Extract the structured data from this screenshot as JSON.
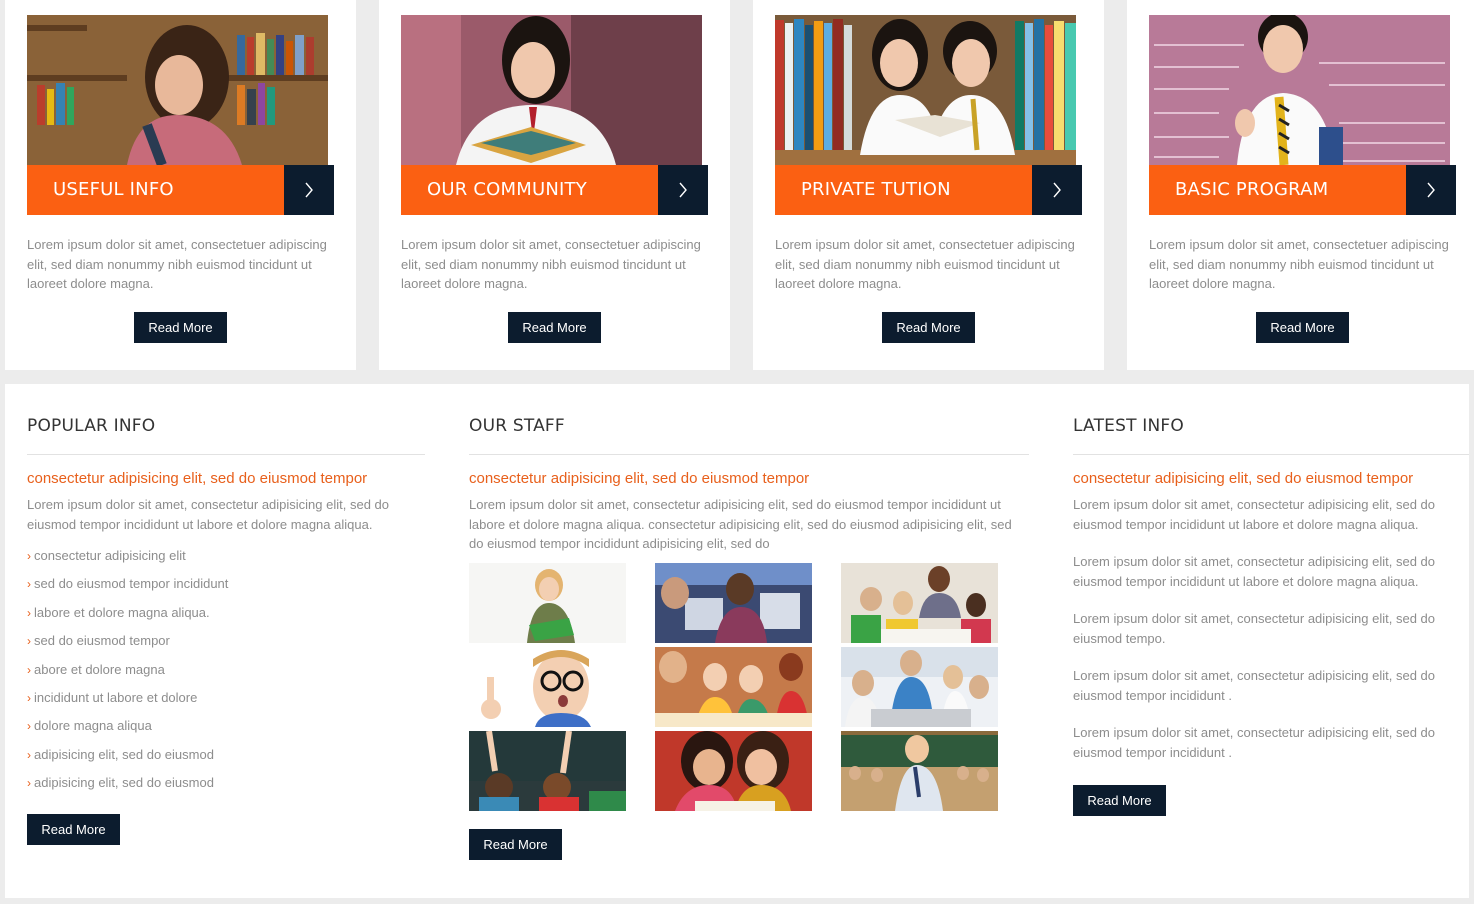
{
  "cards": [
    {
      "title": "USEFUL INFO",
      "desc": "Lorem ipsum dolor sit amet, consectetuer adipiscing elit, sed diam nonummy nibh euismod tincidunt ut laoreet dolore magna.",
      "button": "Read More"
    },
    {
      "title": "OUR COMMUNITY",
      "desc": "Lorem ipsum dolor sit amet, consectetuer adipiscing elit, sed diam nonummy nibh euismod tincidunt ut laoreet dolore magna.",
      "button": "Read More"
    },
    {
      "title": "PRIVATE TUTION",
      "desc": "Lorem ipsum dolor sit amet, consectetuer adipiscing elit, sed diam nonummy nibh euismod tincidunt ut laoreet dolore magna.",
      "button": "Read More"
    },
    {
      "title": "BASIC PROGRAM",
      "desc": "Lorem ipsum dolor sit amet, consectetuer adipiscing elit, sed diam nonummy nibh euismod tincidunt ut laoreet dolore magna.",
      "button": "Read More"
    }
  ],
  "popular": {
    "heading": "POPULAR INFO",
    "subheading": "consectetur adipisicing elit, sed do eiusmod tempor",
    "text": "Lorem ipsum dolor sit amet, consectetur adipisicing elit, sed do eiusmod tempor incididunt ut labore et dolore magna aliqua.",
    "items": [
      "consectetur adipisicing elit",
      "sed do eiusmod tempor incididunt",
      "labore et dolore magna aliqua.",
      "sed do eiusmod tempor",
      "abore et dolore magna",
      "incididunt ut labore et dolore",
      "dolore magna aliqua",
      "adipisicing elit, sed do eiusmod",
      "adipisicing elit, sed do eiusmod"
    ],
    "button": "Read More"
  },
  "staff": {
    "heading": "OUR STAFF",
    "subheading": "consectetur adipisicing elit, sed do eiusmod tempor",
    "text": "Lorem ipsum dolor sit amet, consectetur adipisicing elit, sed do eiusmod tempor incididunt ut labore et dolore magna aliqua. consectetur adipisicing elit, sed do eiusmod adipisicing elit, sed do eiusmod tempor incididunt adipisicing elit, sed do",
    "button": "Read More"
  },
  "latest": {
    "heading": "LATEST INFO",
    "subheading": "consectetur adipisicing elit, sed do eiusmod tempor",
    "paragraphs": [
      "Lorem ipsum dolor sit amet, consectetur adipisicing elit, sed do eiusmod tempor incididunt ut labore et dolore magna aliqua.",
      "Lorem ipsum dolor sit amet, consectetur adipisicing elit, sed do eiusmod tempor incididunt ut labore et dolore magna aliqua.",
      "Lorem ipsum dolor sit amet, consectetur adipisicing elit, sed do eiusmod tempo.",
      "Lorem ipsum dolor sit amet, consectetur adipisicing elit, sed do eiusmod tempor incididunt .",
      "Lorem ipsum dolor sit amet, consectetur adipisicing elit, sed do eiusmod tempor incididunt ."
    ],
    "button": "Read More"
  },
  "colors": {
    "accent": "#fb6012",
    "dark": "#0c1c2e",
    "link": "#e8601c"
  },
  "icons": {
    "card_arrow": "chevron-right-icon",
    "list_bullet": "chevron-right-icon"
  }
}
